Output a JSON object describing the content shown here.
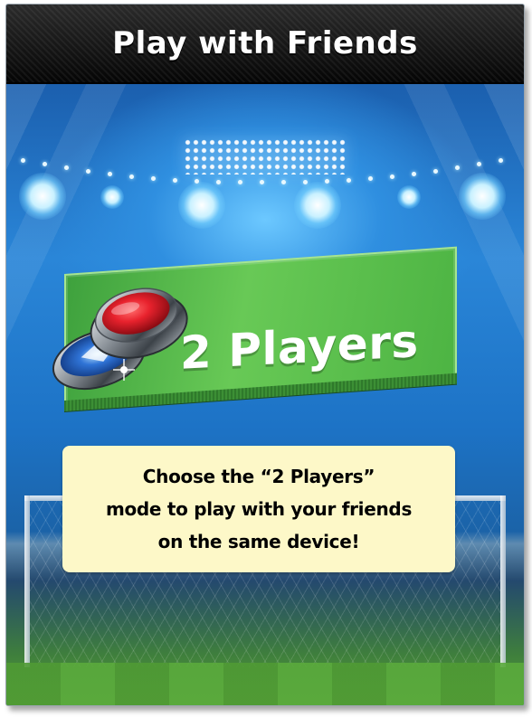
{
  "header": {
    "title": "Play with Friends"
  },
  "mode_card": {
    "label": "2 Players"
  },
  "info": {
    "line1": "Choose the “2 Players”",
    "line2": "mode to play with your friends",
    "line3": "on the same device!"
  },
  "icons": {
    "mode_icon": "red-button-puck-icon"
  },
  "colors": {
    "header_bg": "#111111",
    "sky": "#2a86d8",
    "mode_green": "#5cc04c",
    "puck_red": "#e8222d",
    "info_bg": "#fdf8c8"
  }
}
